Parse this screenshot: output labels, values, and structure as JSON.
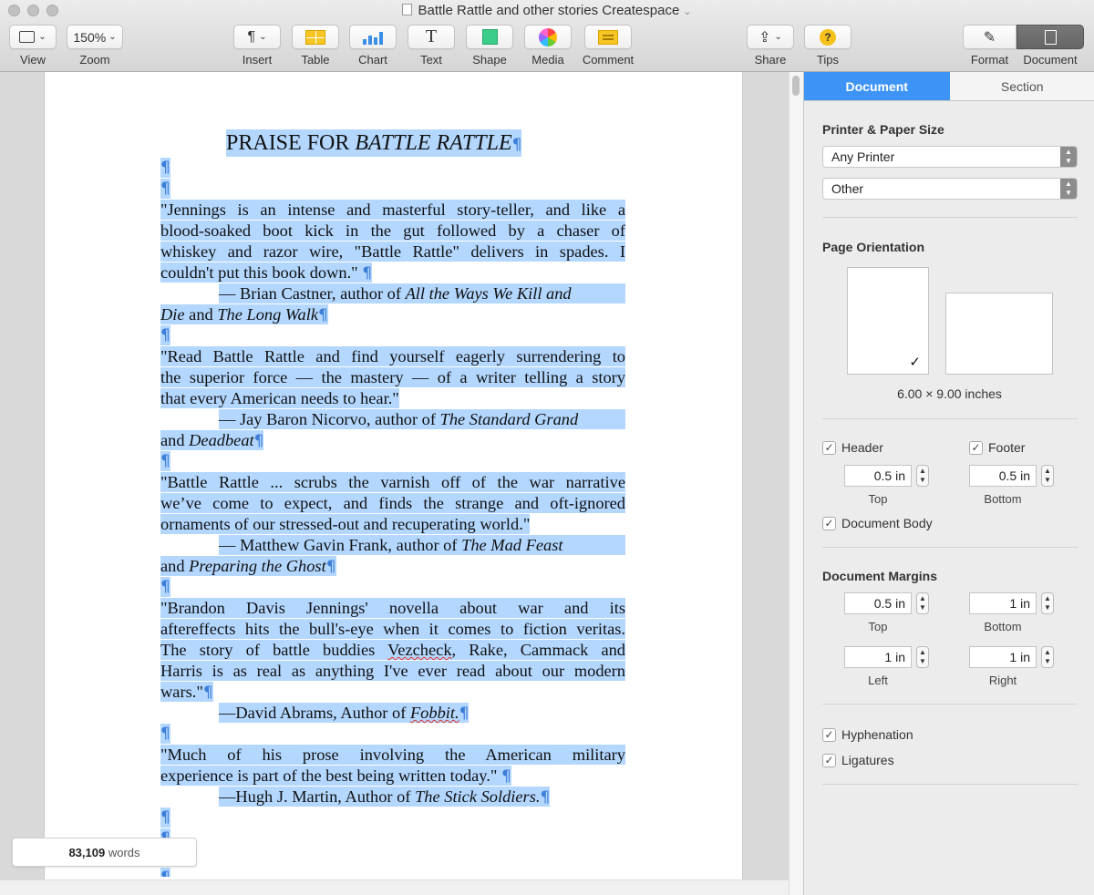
{
  "window": {
    "title": "Battle Rattle and other stories Createspace"
  },
  "toolbar": {
    "view": {
      "label": "View"
    },
    "zoom": {
      "value": "150%",
      "label": "Zoom"
    },
    "insert": {
      "label": "Insert"
    },
    "table": {
      "label": "Table"
    },
    "chart": {
      "label": "Chart"
    },
    "text": {
      "label": "Text",
      "glyph": "T"
    },
    "shape": {
      "label": "Shape"
    },
    "media": {
      "label": "Media"
    },
    "comment": {
      "label": "Comment"
    },
    "share": {
      "label": "Share"
    },
    "tips": {
      "label": "Tips",
      "glyph": "?"
    },
    "format": {
      "label": "Format"
    },
    "document": {
      "label": "Document"
    }
  },
  "document": {
    "pilcrow": "¶",
    "title_prefix": "PRAISE FOR ",
    "title_italic": "BATTLE RATTLE",
    "q1": {
      "l1": "\"Jennings is an intense and masterful story-teller, and like a",
      "l2": "blood-soaked boot kick in the gut followed by a chaser of",
      "l3": "whiskey and razor wire, \"Battle Rattle\" delivers in spades. I",
      "l4": "couldn't put this book down.\" ",
      "a1": "— Brian Castner, author of ",
      "a1i": "All the Ways We Kill and",
      "a2i": "Die",
      "a2": " and ",
      "a2i2": "The Long Walk"
    },
    "q2": {
      "l1": "\"Read Battle Rattle and find yourself eagerly surrendering to",
      "l2": "the superior force — the mastery — of a writer telling a story",
      "l3": "that every American needs to hear.\"",
      "a1": "— Jay Baron Nicorvo, author of ",
      "a1i": "The Standard Grand",
      "a2": "and ",
      "a2i": "Deadbeat"
    },
    "q3": {
      "l1": "\"Battle Rattle ... scrubs the varnish off of the war narrative",
      "l2": "we’ve come to expect, and finds the strange and oft-ignored",
      "l3": "ornaments of our stressed-out and recuperating world.\"",
      "a1": "— Matthew Gavin Frank, author of ",
      "a1i": "The Mad Feast",
      "a2": "and ",
      "a2i": "Preparing the Ghost"
    },
    "q4": {
      "l1": "\"Brandon Davis Jennings' novella about war and its",
      "l2": "aftereffects hits the bull's-eye when it comes to fiction veritas.",
      "l3a": "The story of battle buddies ",
      "l3b": "Vezcheck",
      "l3c": ", Rake, Cammack and",
      "l4": "Harris is as real as anything I've ever read about our modern",
      "l5": "wars.\"",
      "a1": "—David Abrams, Author of ",
      "a1i": "Fobbit."
    },
    "q5": {
      "l1": "\"Much of his prose involving the American military",
      "l2": "experience is part of the best being written today.\" ",
      "a1": "—Hugh J. Martin, Author of ",
      "a1i": "The Stick Soldiers."
    }
  },
  "word_count": {
    "number": "83,109",
    "unit": "words"
  },
  "inspector": {
    "tabs": [
      "Document",
      "Section"
    ],
    "printer_paper": {
      "title": "Printer & Paper Size",
      "printer": "Any Printer",
      "paper": "Other"
    },
    "orientation": {
      "title": "Page Orientation",
      "selected": "portrait",
      "size": "6.00 × 9.00 inches"
    },
    "header": {
      "label": "Header",
      "checked": true,
      "value": "0.5 in",
      "sublabel": "Top"
    },
    "footer": {
      "label": "Footer",
      "checked": true,
      "value": "0.5 in",
      "sublabel": "Bottom"
    },
    "document_body": {
      "label": "Document Body",
      "checked": true
    },
    "margins": {
      "title": "Document Margins",
      "top": {
        "value": "0.5 in",
        "label": "Top"
      },
      "bottom": {
        "value": "1 in",
        "label": "Bottom"
      },
      "left": {
        "value": "1 in",
        "label": "Left"
      },
      "right": {
        "value": "1 in",
        "label": "Right"
      }
    },
    "hyphenation": {
      "label": "Hyphenation",
      "checked": true
    },
    "ligatures": {
      "label": "Ligatures",
      "checked": true
    }
  }
}
